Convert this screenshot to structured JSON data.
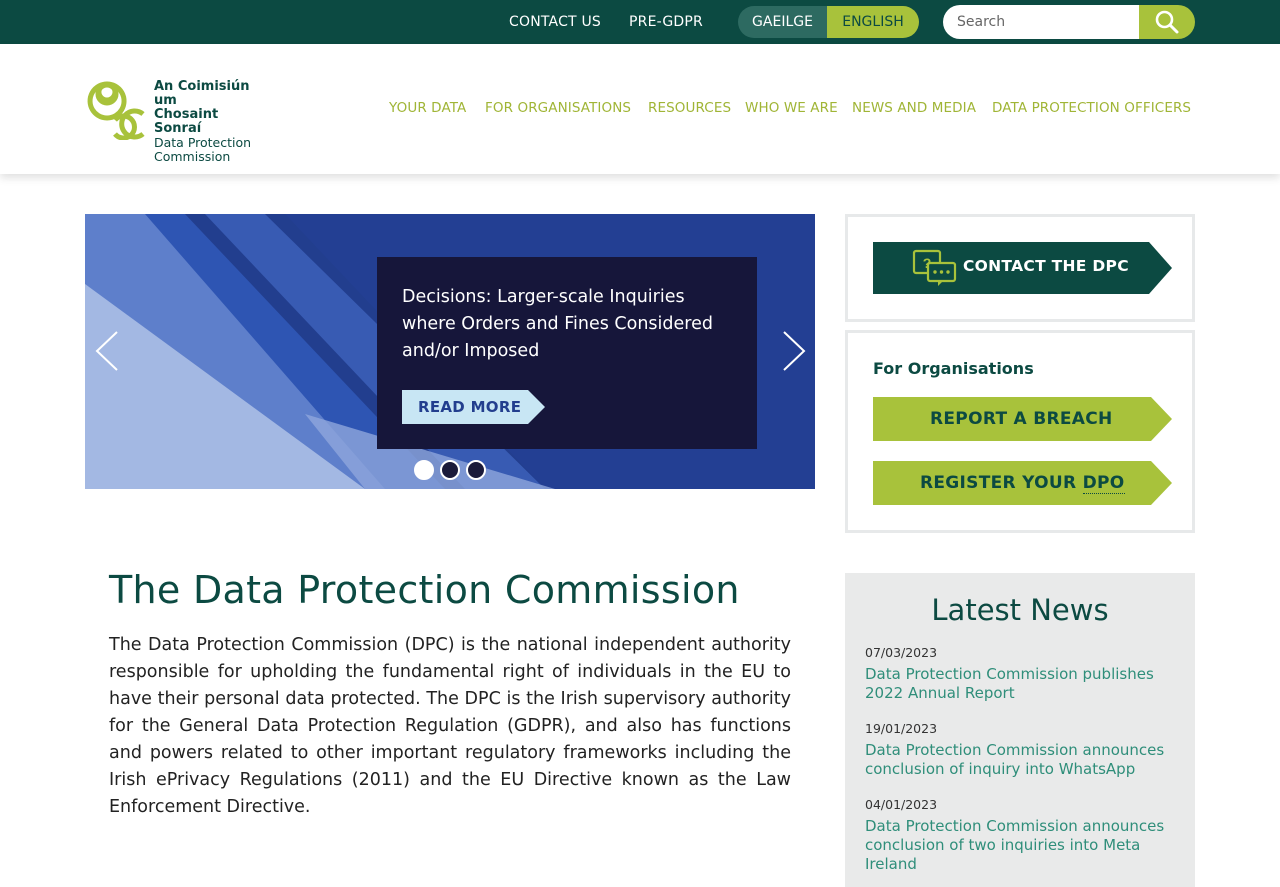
{
  "topbar": {
    "contact_us": "CONTACT US",
    "pre_gdpr": "PRE-GDPR",
    "lang_gaeilge": "GAEILGE",
    "lang_english": "ENGLISH",
    "search_placeholder": "Search"
  },
  "logo": {
    "line1": "An Coimisiún um",
    "line2": "Chosaint Sonraí",
    "line3": "Data Protection",
    "line4": "Commission"
  },
  "nav": {
    "items": [
      {
        "label": "YOUR DATA"
      },
      {
        "label": "FOR ORGANISATIONS"
      },
      {
        "label": "RESOURCES"
      },
      {
        "label": "WHO WE ARE"
      },
      {
        "label": "NEWS AND MEDIA"
      },
      {
        "label": "DATA PROTECTION OFFICERS"
      }
    ]
  },
  "carousel": {
    "caption": "Decisions: Larger-scale Inquiries where Orders and Fines Considered and/or Imposed",
    "read_more": "READ MORE",
    "active_slide": 1,
    "slide_count": 3
  },
  "sidebar": {
    "contact_dpc": "CONTACT THE DPC",
    "for_organisations": "For Organisations",
    "report_breach": "REPORT A BREACH",
    "register_your": "REGISTER YOUR",
    "dpo": "DPO"
  },
  "main": {
    "title": "The Data Protection Commission",
    "body": "The Data Protection Commission (DPC) is the national independent authority responsible for upholding the fundamental right of individuals in the EU to have their personal data protected. The DPC is the Irish supervisory authority for the General Data Protection Regulation (GDPR), and also has functions and powers related to other important regulatory frameworks including the Irish ePrivacy Regulations (2011) and the EU Directive known as the Law Enforcement Directive."
  },
  "news": {
    "heading": "Latest News",
    "items": [
      {
        "date": "07/03/2023",
        "title": "Data Protection Commission publishes 2022 Annual Report"
      },
      {
        "date": "19/01/2023",
        "title": "Data Protection Commission announces conclusion of inquiry into WhatsApp"
      },
      {
        "date": "04/01/2023",
        "title": "Data Protection Commission announces conclusion of two inquiries into Meta Ireland"
      }
    ]
  },
  "colors": {
    "brand_dark_green": "#0c4a42",
    "brand_lime": "#a8c23b",
    "carousel_blue": "#223e8e",
    "link_teal": "#2f8e7a"
  }
}
